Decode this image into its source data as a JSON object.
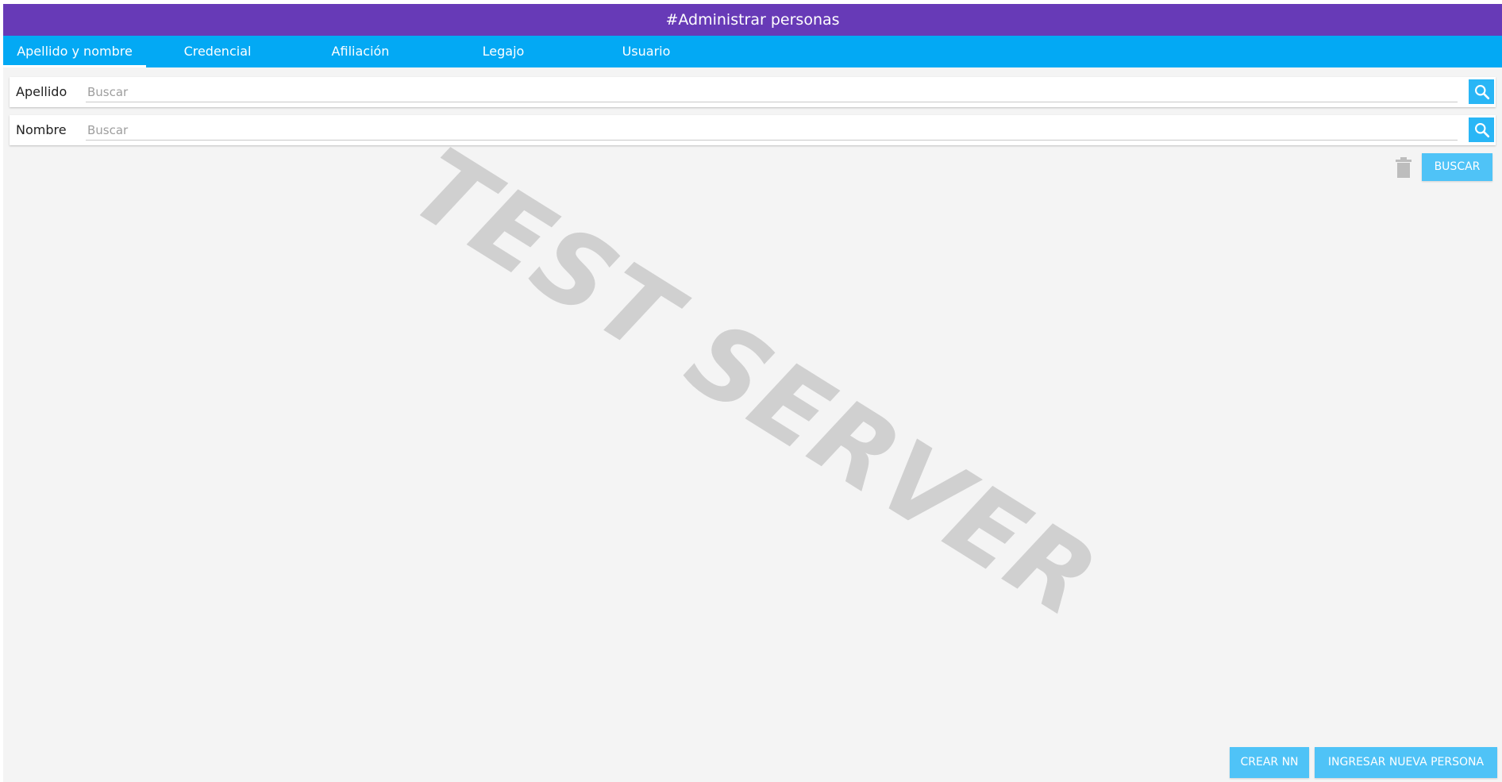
{
  "header": {
    "title": "#Administrar personas"
  },
  "tabs": [
    {
      "label": "Apellido y nombre",
      "active": true
    },
    {
      "label": "Credencial",
      "active": false
    },
    {
      "label": "Afiliación",
      "active": false
    },
    {
      "label": "Legajo",
      "active": false
    },
    {
      "label": "Usuario",
      "active": false
    }
  ],
  "search": {
    "apellido": {
      "label": "Apellido",
      "placeholder": "Buscar",
      "value": ""
    },
    "nombre": {
      "label": "Nombre",
      "placeholder": "Buscar",
      "value": ""
    }
  },
  "actions": {
    "buscar_label": "BUSCAR",
    "crear_nn_label": "CREAR NN",
    "ingresar_label": "INGRESAR NUEVA PERSONA"
  },
  "watermark": {
    "text": "TEST SERVER"
  },
  "colors": {
    "header": "#673ab7",
    "tabbar": "#03a9f4",
    "button": "#4fc3f7",
    "background": "#f4f4f4"
  },
  "icons": {
    "search": "search-icon",
    "trash": "trash-icon"
  }
}
